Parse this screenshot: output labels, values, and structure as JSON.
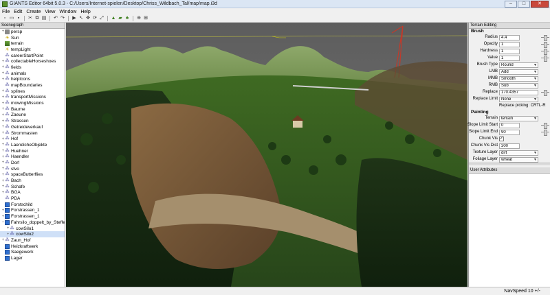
{
  "window": {
    "title": "GIANTS Editor 64bit 5.0.3 - C:/Users/Internet-spielen/Desktop/Chriss_Wildbach_Tal/map/map.i3d",
    "min": "–",
    "max": "□",
    "close": "✕"
  },
  "menu": [
    "File",
    "Edit",
    "Create",
    "View",
    "Window",
    "Help"
  ],
  "toolbar": [
    "new-icon",
    "open-icon",
    "save-icon",
    "cut-icon",
    "copy-icon",
    "paste-icon",
    "undo-icon",
    "redo-icon",
    "select-icon",
    "move-icon",
    "rotate-icon",
    "scale-icon",
    "terrain-sculpt-icon",
    "paint-icon",
    "foliage-icon",
    "play-icon",
    "navigate-icon",
    "grid-icon"
  ],
  "scenegraph": {
    "title": "Scenegraph",
    "items": [
      {
        "label": "persp",
        "icon": "camera",
        "exp": "+"
      },
      {
        "label": "Sun",
        "icon": "light",
        "exp": ""
      },
      {
        "label": "terrain",
        "icon": "terrain",
        "exp": ""
      },
      {
        "label": "tempLight",
        "icon": "light",
        "exp": ""
      },
      {
        "label": "careerStartPoint",
        "icon": "group",
        "exp": ""
      },
      {
        "label": "collectableHorseshoes",
        "icon": "group",
        "exp": "+"
      },
      {
        "label": "fields",
        "icon": "group",
        "exp": "+"
      },
      {
        "label": "animals",
        "icon": "group",
        "exp": "+"
      },
      {
        "label": "helpIcons",
        "icon": "group",
        "exp": "+"
      },
      {
        "label": "mapBoundaries",
        "icon": "group",
        "exp": ""
      },
      {
        "label": "splines",
        "icon": "group",
        "exp": "+"
      },
      {
        "label": "transportMissions",
        "icon": "group",
        "exp": "+"
      },
      {
        "label": "mowingMissions",
        "icon": "group",
        "exp": "+"
      },
      {
        "label": "Baume",
        "icon": "group",
        "exp": "+"
      },
      {
        "label": "Zaeune",
        "icon": "group",
        "exp": "+"
      },
      {
        "label": "Strassen",
        "icon": "group",
        "exp": "+"
      },
      {
        "label": "Getreideverkauf",
        "icon": "group",
        "exp": "+"
      },
      {
        "label": "Strommasten",
        "icon": "group",
        "exp": "+"
      },
      {
        "label": "Hof",
        "icon": "group",
        "exp": "+"
      },
      {
        "label": "LaendicheObjekte",
        "icon": "group",
        "exp": "+"
      },
      {
        "label": "Huehner",
        "icon": "group",
        "exp": "+"
      },
      {
        "label": "Haendler",
        "icon": "group",
        "exp": "+"
      },
      {
        "label": "Dorf",
        "icon": "group",
        "exp": "+"
      },
      {
        "label": "stvo",
        "icon": "group",
        "exp": "+"
      },
      {
        "label": "spaceButterflies",
        "icon": "group",
        "exp": "+"
      },
      {
        "label": "Bach",
        "icon": "group",
        "exp": "+"
      },
      {
        "label": "Schafe",
        "icon": "group",
        "exp": "+"
      },
      {
        "label": "BGA",
        "icon": "group",
        "exp": "+"
      },
      {
        "label": "PDA",
        "icon": "group",
        "exp": ""
      },
      {
        "label": "Forstschild",
        "icon": "shape",
        "exp": ""
      },
      {
        "label": "Forstrassen_1",
        "icon": "shape",
        "exp": "+"
      },
      {
        "label": "Forstrassen_1",
        "icon": "shape",
        "exp": "+"
      },
      {
        "label": "Fahrsilo_doppelt_by_Steffe",
        "icon": "shape",
        "exp": "−"
      },
      {
        "label": "cowSilo1",
        "icon": "group",
        "exp": "+",
        "indent": 1
      },
      {
        "label": "cowSilo2",
        "icon": "group",
        "exp": "+",
        "indent": 1
      },
      {
        "label": "Zaun_Hof",
        "icon": "group",
        "exp": "+"
      },
      {
        "label": "Heizkraftwerk",
        "icon": "shape",
        "exp": ""
      },
      {
        "label": "Saegewerk",
        "icon": "shape",
        "exp": ""
      },
      {
        "label": "Lager",
        "icon": "shape",
        "exp": ""
      }
    ]
  },
  "terrain_editing": {
    "title": "Terrain Editing",
    "brush_section": "Brush",
    "radius": {
      "label": "Radius",
      "value": "4.4"
    },
    "opacity": {
      "label": "Opacity",
      "value": "1"
    },
    "hardness": {
      "label": "Hardness",
      "value": "1"
    },
    "value": {
      "label": "Value",
      "value": "1"
    },
    "brush_type": {
      "label": "Brush Type",
      "value": "Round"
    },
    "lmb": {
      "label": "LMB",
      "value": "Add"
    },
    "mmb": {
      "label": "MMB",
      "value": "Smooth"
    },
    "rmb": {
      "label": "RMB",
      "value": "Sub"
    },
    "replace": {
      "label": "Replace",
      "value": "170.4357"
    },
    "replace_limit": {
      "label": "Replace Limit",
      "value": "None"
    },
    "replace_picking": "Replace picking: CRTL-R",
    "painting_section": "Painting",
    "terrain": {
      "label": "Terrain",
      "value": "terrain"
    },
    "slope_start": {
      "label": "Slope Limit Start",
      "value": "0"
    },
    "slope_end": {
      "label": "Slope Limit End",
      "value": "90"
    },
    "chunk_vis": {
      "label": "Chunk Vis",
      "value": "✓"
    },
    "chunk_vis_dist": {
      "label": "Chunk Vis Dist",
      "value": "300"
    },
    "texture_layer": {
      "label": "Texture Layer",
      "value": "dirt"
    },
    "foliage_layer": {
      "label": "Foliage Layer",
      "value": "wheat"
    }
  },
  "user_attributes": {
    "title": "User Attributes"
  },
  "status": {
    "navspeed": "NavSpeed 10 +/-"
  }
}
